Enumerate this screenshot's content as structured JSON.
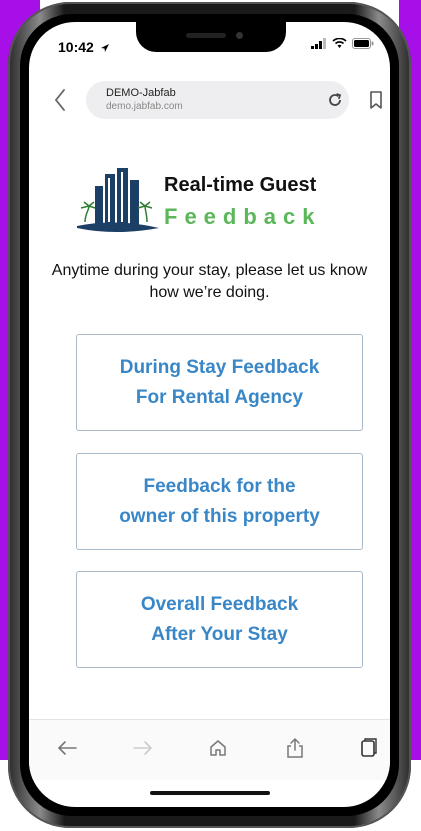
{
  "status_bar": {
    "time": "10:42"
  },
  "browser": {
    "title": "DEMO-Jabfab",
    "domain": "demo.jabfab.com"
  },
  "brand": {
    "line1": "Real-time Guest",
    "line2": "Feedback",
    "accent_color": "#5bb75a",
    "logo_color": "#1c3f66"
  },
  "intro_text": "Anytime during your stay, please let us know how we’re doing.",
  "buttons": [
    {
      "label": "During Stay Feedback\nFor Rental Agency"
    },
    {
      "label": "Feedback for the\nowner of this property"
    },
    {
      "label": "Overall Feedback\nAfter Your Stay"
    }
  ],
  "colors": {
    "background_accent": "#a70fe8",
    "button_text": "#3a87c8",
    "button_border": "#a9b9c9"
  },
  "icons": [
    "back-chevron-icon",
    "reload-icon",
    "bookmark-icon",
    "back-arrow-icon",
    "forward-arrow-icon",
    "home-icon",
    "share-icon",
    "tabs-icon"
  ]
}
